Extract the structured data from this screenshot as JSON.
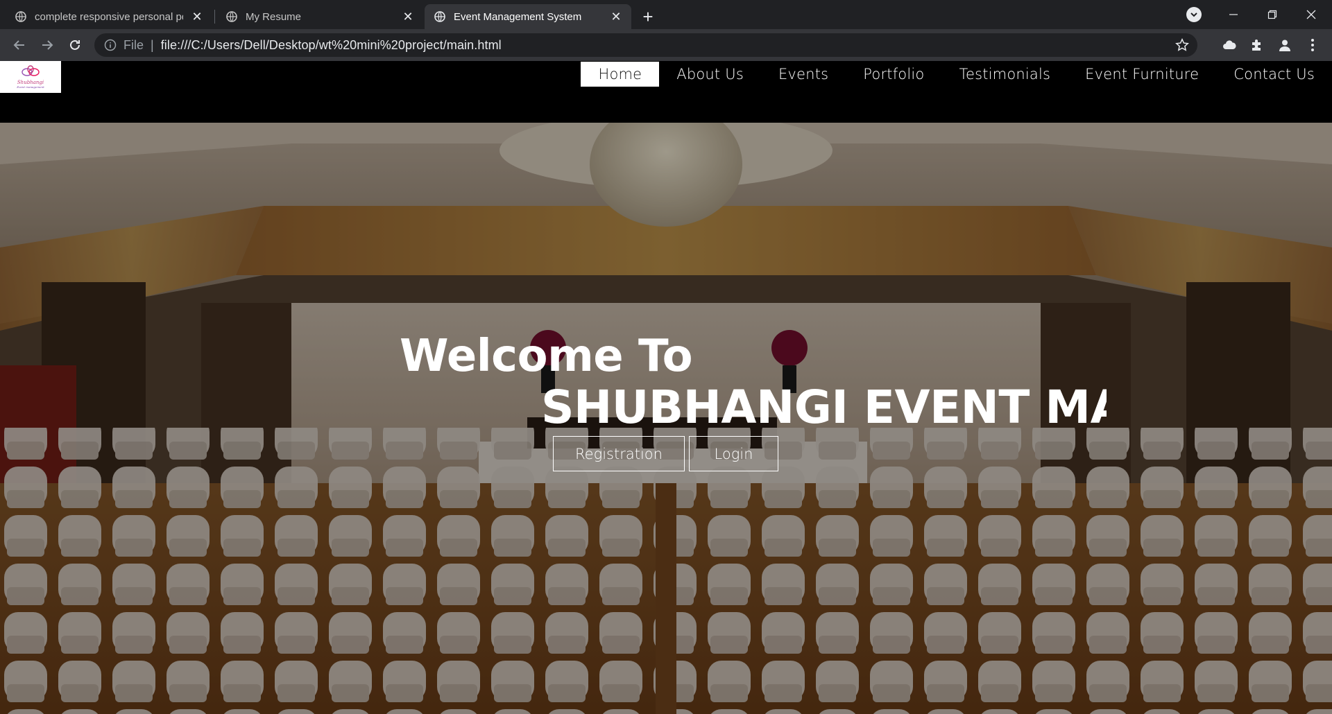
{
  "browser": {
    "tabs": [
      {
        "title": "complete responsive personal po",
        "active": false
      },
      {
        "title": "My Resume",
        "active": false
      },
      {
        "title": "Event Management System",
        "active": true
      }
    ],
    "newtab_icon": "plus-icon",
    "address": {
      "scheme_label": "File",
      "url": "file:///C:/Users/Dell/Desktop/wt%20mini%20project/main.html"
    },
    "colors": {
      "tabstrip": "#202124",
      "toolbar": "#35363a",
      "omnibox": "#202124"
    }
  },
  "site": {
    "logo": {
      "text": "Shubhangi",
      "subtext": "Event management"
    },
    "nav": [
      {
        "label": "Home",
        "active": true
      },
      {
        "label": "About Us",
        "active": false
      },
      {
        "label": "Events",
        "active": false
      },
      {
        "label": "Portfolio",
        "active": false
      },
      {
        "label": "Testimonials",
        "active": false
      },
      {
        "label": "Event Furniture",
        "active": false
      },
      {
        "label": "Contact Us",
        "active": false
      }
    ],
    "hero": {
      "welcome": "Welcome To",
      "title": "SHUBHANGI EVENT MANAG",
      "buttons": {
        "registration": "Registration",
        "login": "Login"
      },
      "background": "banquet-hall-photo"
    }
  }
}
